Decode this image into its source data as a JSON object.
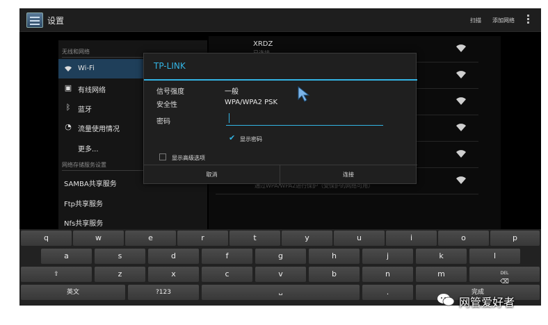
{
  "actionbar": {
    "title": "设置",
    "scan_label": "扫描",
    "add_network_label": "添加网络"
  },
  "sidebar": {
    "section_wireless": "无线和网络",
    "items": [
      {
        "label": "Wi-Fi",
        "icon": "wifi-icon"
      },
      {
        "label": "有线网络",
        "icon": "ethernet-icon"
      },
      {
        "label": "蓝牙",
        "icon": "bluetooth-icon"
      },
      {
        "label": "流量使用情况",
        "icon": "data-usage-icon"
      },
      {
        "label": "更多..."
      }
    ],
    "section_storage": "网络存储服务设置",
    "storage_items": [
      {
        "label": "SAMBA共享服务"
      },
      {
        "label": "Ftp共享服务"
      },
      {
        "label": "Nfs共享服务"
      }
    ]
  },
  "wifi_list": {
    "networks": [
      {
        "ssid": "XRDZ",
        "status": "已连接"
      },
      {
        "ssid": ""
      },
      {
        "ssid": ""
      },
      {
        "ssid": ""
      },
      {
        "ssid": ""
      },
      {
        "ssid": ""
      }
    ],
    "behind_text": "通过WPA/WPA2进行保护（受保护的网络可用）"
  },
  "dialog": {
    "title": "TP-LINK",
    "signal_label": "信号强度",
    "signal_value": "一般",
    "security_label": "安全性",
    "security_value": "WPA/WPA2 PSK",
    "password_label": "密码",
    "password_value": "",
    "show_password_label": "显示密码",
    "show_password_checked": true,
    "advanced_label": "显示高级选项",
    "advanced_checked": false,
    "cancel_label": "取消",
    "connect_label": "连接"
  },
  "keyboard": {
    "row1": [
      "q",
      "w",
      "e",
      "r",
      "t",
      "y",
      "u",
      "i",
      "o",
      "p"
    ],
    "row2": [
      "a",
      "s",
      "d",
      "f",
      "g",
      "h",
      "j",
      "k",
      "l"
    ],
    "row3": [
      "z",
      "x",
      "c",
      "v",
      "b",
      "n",
      "m"
    ],
    "row3_hints": {
      "shift": "",
      "del": "DEL"
    },
    "lang_label": "英文",
    "sym_label": "?123",
    "period_label": ".",
    "enter_label": "完成"
  },
  "watermark": {
    "text": "网管爱好者"
  },
  "colors": {
    "accent": "#33b5e5",
    "active_row": "#1f3f5a"
  }
}
